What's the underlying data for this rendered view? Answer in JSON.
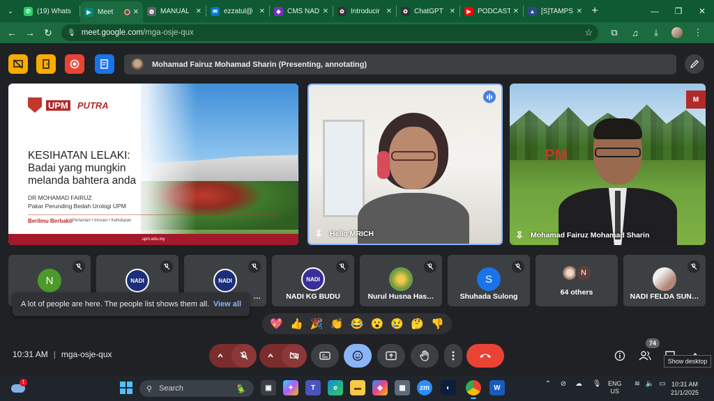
{
  "browser": {
    "tabs": [
      {
        "label": "(19) Whats",
        "icon": "whatsapp-icon",
        "color": "#25d366"
      },
      {
        "label": "Meet",
        "icon": "meet-icon",
        "color": "#00897b",
        "active": true
      },
      {
        "label": "MANUAL",
        "icon": "globe-icon",
        "color": "#5f6368"
      },
      {
        "label": "ezzatul@",
        "icon": "mail-icon",
        "color": "#0078d4"
      },
      {
        "label": "CMS NAD",
        "icon": "cms-icon",
        "color": "#7b2fbe"
      },
      {
        "label": "Introducir",
        "icon": "openai-icon",
        "color": "#333333"
      },
      {
        "label": "ChatGPT",
        "icon": "chatgpt-icon",
        "color": "#333333"
      },
      {
        "label": "PODCAST",
        "icon": "youtube-icon",
        "color": "#ff0000"
      },
      {
        "label": "[S]TAMPS",
        "icon": "stamps-icon",
        "color": "#2b4a8a"
      }
    ],
    "url_host": "meet.google.com",
    "url_path": "/mga-osje-qux"
  },
  "meet": {
    "presenter_label": "Mohamad Fairuz Mohamad Sharin (Presenting, annotating)",
    "slide": {
      "brand_upm": "UPM",
      "brand_putra": "PUTRA",
      "title_line1": "KESIHATAN LELAKI:",
      "title_line2": "Badai yang mungkin",
      "title_line3": "melanda bahtera anda",
      "author": "DR MOHAMAD FAIRUZ",
      "author_role": "Pakar Perunding Bedah Urologi UPM",
      "tagline": "Berilmu Berbakti",
      "tagline_sub": "Pertanian • Inovasi • Kehidupan",
      "footer": "upm.edu.my"
    },
    "tile_hello_name": "Hello MRICH",
    "tile_fairuz_name": "Mohamad Fairuz Mohamad Sharin",
    "tile_fairuz_sign": "PM",
    "participants": [
      {
        "name": "",
        "initial": "N",
        "color": "#4c9a2a"
      },
      {
        "name": "",
        "initial": "NADI",
        "color": "#1b2f7a"
      },
      {
        "name": "…",
        "initial": "NADI",
        "color": "#1b2f7a"
      },
      {
        "name": "NADI KG BUDU",
        "initial": "NADI",
        "color": "#3a2f9a"
      },
      {
        "name": "Nurul Husna Has…",
        "initial": "",
        "color": "#c9a233"
      },
      {
        "name": "Shuhada Sulong",
        "initial": "S",
        "color": "#1a73e8"
      },
      {
        "name": "64 others",
        "initial": "N",
        "color": "#5d4037"
      },
      {
        "name": "NADI FELDA SUN…",
        "initial": "",
        "color": "#d9c9c0"
      }
    ],
    "toast_text": "A lot of people are here. The people list shows them all.",
    "toast_action": "View all",
    "reactions": [
      "💖",
      "👍",
      "🎉",
      "👏",
      "😂",
      "😮",
      "😢",
      "🤔",
      "👎"
    ],
    "time": "10:31 AM",
    "meeting_code": "mga-osje-qux",
    "people_count": "74",
    "tooltip": "Show desktop"
  },
  "taskbar": {
    "weather_badge": "1",
    "search_placeholder": "Search",
    "lang_line1": "ENG",
    "lang_line2": "US",
    "clock_time": "10:31 AM",
    "clock_date": "21/1/2025"
  }
}
